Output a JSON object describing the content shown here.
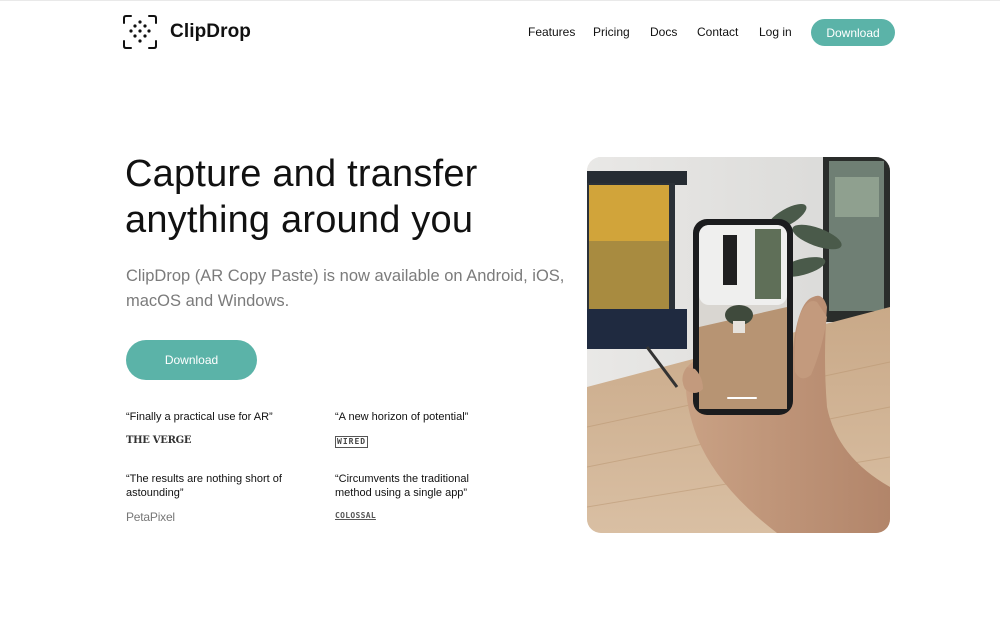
{
  "header": {
    "brand": "ClipDrop",
    "nav": [
      "Features",
      "Pricing",
      "Docs",
      "Contact",
      "Log in"
    ],
    "download_label": "Download"
  },
  "hero": {
    "title_line1": "Capture and transfer",
    "title_line2": "anything around you",
    "subtitle": "ClipDrop (AR Copy Paste) is now available on Android, iOS, macOS and Windows.",
    "download_label": "Download"
  },
  "quotes": [
    {
      "text": "“Finally a practical use for AR”",
      "source": "THE VERGE"
    },
    {
      "text": "“A new horizon of potential”",
      "source": "WIRED"
    },
    {
      "text": "“The results are nothing short of astounding”",
      "source": "PetaPixel"
    },
    {
      "text": "“Circumvents the traditional method using a single app”",
      "source": "COLOSSAL"
    }
  ],
  "colors": {
    "accent": "#5bb3a8",
    "text": "#111111",
    "muted": "#7b7b7b"
  }
}
